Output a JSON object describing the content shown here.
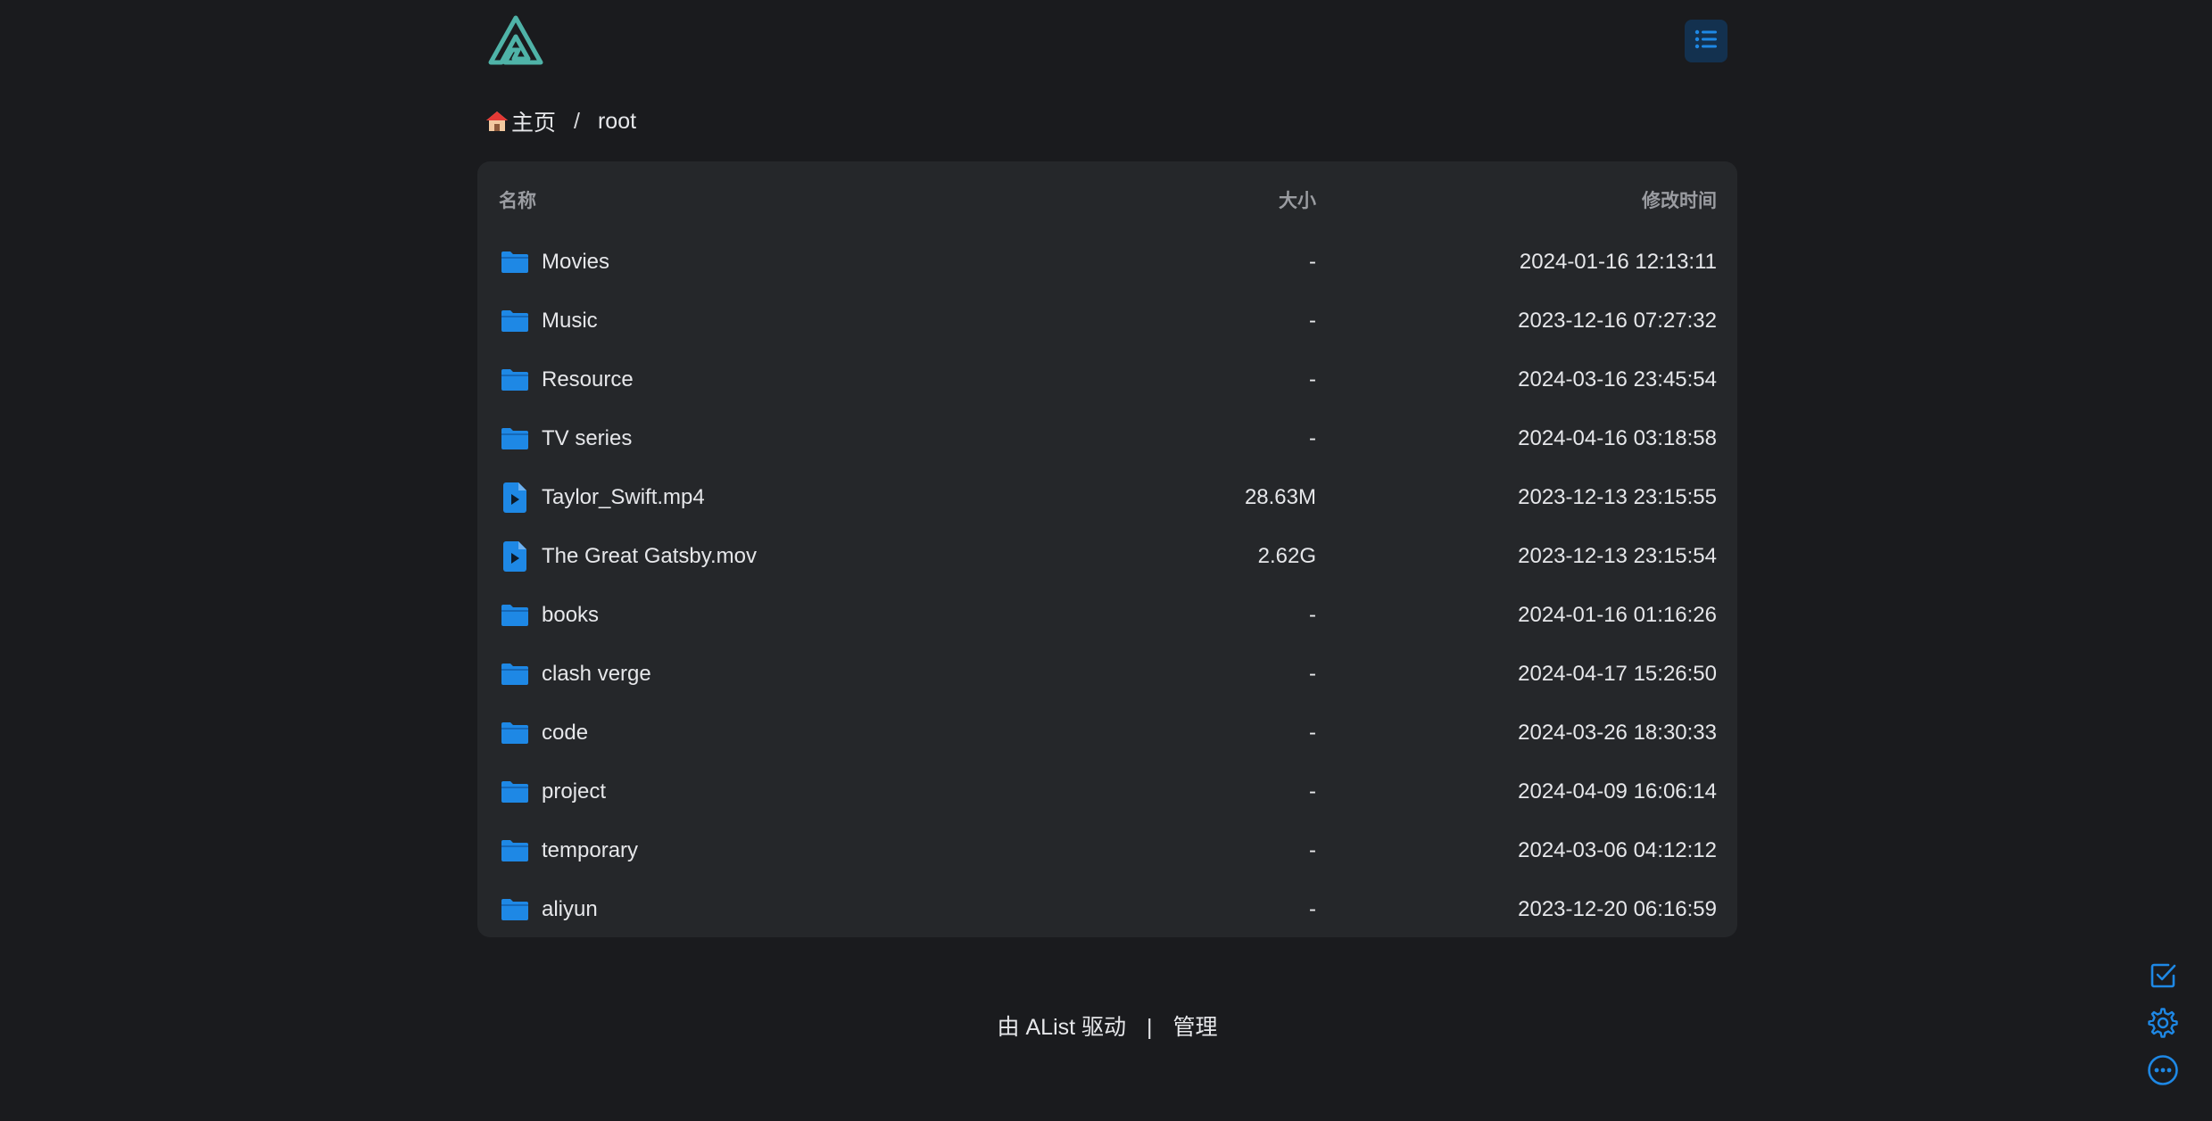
{
  "brand": {
    "accent": "#1e88e5",
    "logo_color": "#4fb3a8"
  },
  "header": {
    "logo_icon": "alist-logo-icon",
    "view_toggle_icon": "list-view-icon"
  },
  "breadcrumb": {
    "home_icon": "house-icon",
    "home_label": "主页",
    "separator": "/",
    "current": "root"
  },
  "list": {
    "columns": {
      "name": "名称",
      "size": "大小",
      "modified": "修改时间"
    },
    "items": [
      {
        "type": "folder",
        "icon": "folder-icon",
        "name": "Movies",
        "size": "-",
        "modified": "2024-01-16 12:13:11"
      },
      {
        "type": "folder",
        "icon": "folder-icon",
        "name": "Music",
        "size": "-",
        "modified": "2023-12-16 07:27:32"
      },
      {
        "type": "folder",
        "icon": "folder-icon",
        "name": "Resource",
        "size": "-",
        "modified": "2024-03-16 23:45:54"
      },
      {
        "type": "folder",
        "icon": "folder-icon",
        "name": "TV series",
        "size": "-",
        "modified": "2024-04-16 03:18:58"
      },
      {
        "type": "video",
        "icon": "video-file-icon",
        "name": "Taylor_Swift.mp4",
        "size": "28.63M",
        "modified": "2023-12-13 23:15:55"
      },
      {
        "type": "video",
        "icon": "video-file-icon",
        "name": "The Great Gatsby.mov",
        "size": "2.62G",
        "modified": "2023-12-13 23:15:54"
      },
      {
        "type": "folder",
        "icon": "folder-icon",
        "name": "books",
        "size": "-",
        "modified": "2024-01-16 01:16:26"
      },
      {
        "type": "folder",
        "icon": "folder-icon",
        "name": "clash verge",
        "size": "-",
        "modified": "2024-04-17 15:26:50"
      },
      {
        "type": "folder",
        "icon": "folder-icon",
        "name": "code",
        "size": "-",
        "modified": "2024-03-26 18:30:33"
      },
      {
        "type": "folder",
        "icon": "folder-icon",
        "name": "project",
        "size": "-",
        "modified": "2024-04-09 16:06:14"
      },
      {
        "type": "folder",
        "icon": "folder-icon",
        "name": "temporary",
        "size": "-",
        "modified": "2024-03-06 04:12:12"
      },
      {
        "type": "folder",
        "icon": "folder-icon",
        "name": "aliyun",
        "size": "-",
        "modified": "2023-12-20 06:16:59"
      }
    ]
  },
  "footer": {
    "powered_by": "由 AList 驱动",
    "separator": "|",
    "manage": "管理"
  },
  "tools": [
    {
      "icon": "checkbox-icon"
    },
    {
      "icon": "gear-icon"
    },
    {
      "icon": "more-icon"
    }
  ]
}
